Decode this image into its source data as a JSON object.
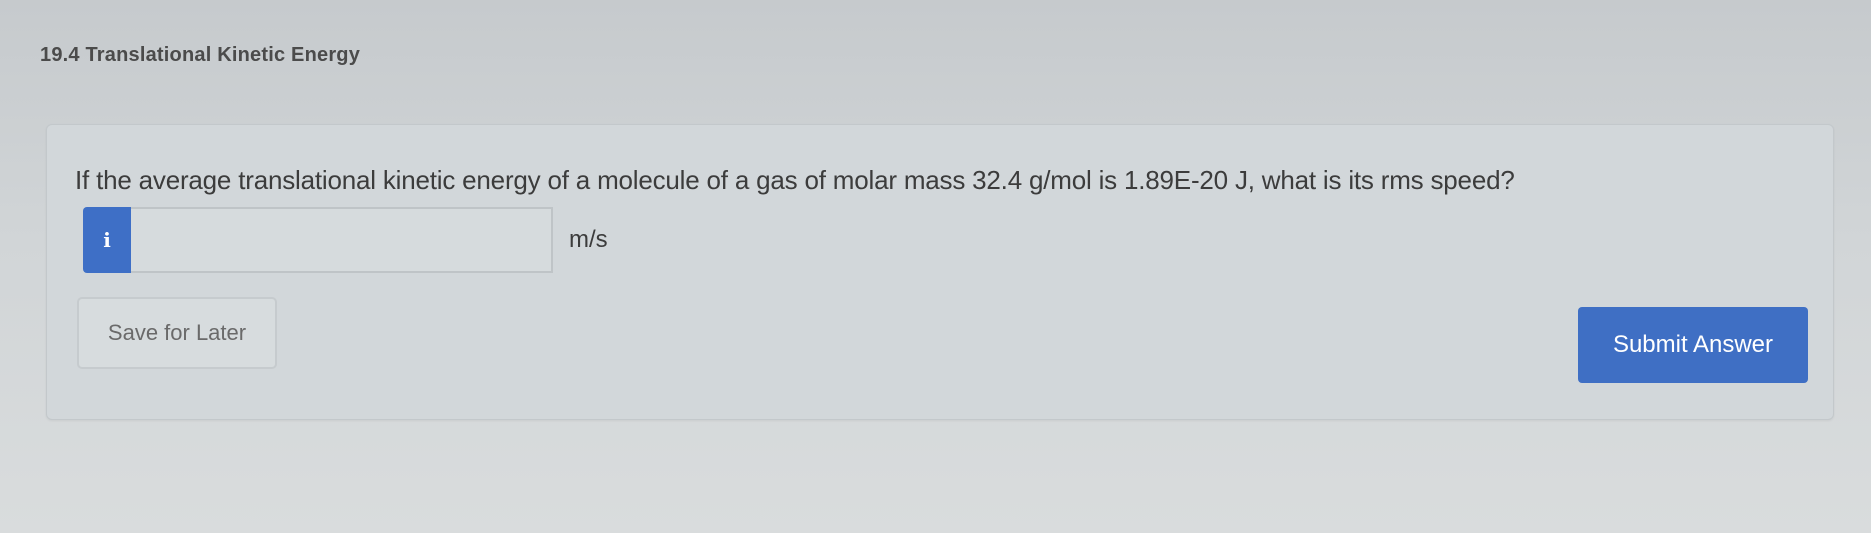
{
  "section": {
    "title": "19.4 Translational Kinetic Energy"
  },
  "question": {
    "text": "If the average translational kinetic energy of a molecule of a gas of molar mass 32.4 g/mol is 1.89E-20 J, what is its rms speed?",
    "info_icon": "i",
    "answer_value": "",
    "unit": "m/s"
  },
  "actions": {
    "save_label": "Save for Later",
    "submit_label": "Submit Answer"
  },
  "colors": {
    "accent": "#3f6fc4",
    "background": "#d0d4d6"
  },
  "icons": {
    "info_badge": "info-icon"
  }
}
